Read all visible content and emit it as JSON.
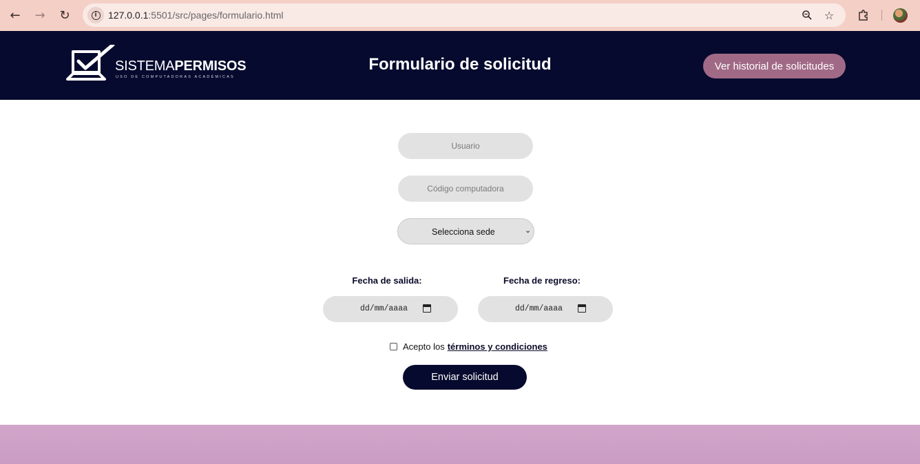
{
  "browser": {
    "url_host": "127.0.0.1",
    "url_path": ":5501/src/pages/formulario.html",
    "back_icon": "arrow-left-icon",
    "forward_icon": "arrow-right-icon",
    "reload_icon": "reload-icon",
    "zoom_icon": "zoom-out-icon",
    "bookmark_icon": "star-icon",
    "extensions_icon": "puzzle-icon"
  },
  "header": {
    "logo_light": "SISTEMA",
    "logo_bold": "PERMISOS",
    "logo_tagline": "USO DE COMPUTADORAS ACADÉMICAS",
    "title": "Formulario de solicitud",
    "history_button": "Ver historial de solicitudes"
  },
  "form": {
    "user_placeholder": "Usuario",
    "computer_code_placeholder": "Código computadora",
    "site_select": "Selecciona sede",
    "departure_label": "Fecha de salida:",
    "return_label": "Fecha de regreso:",
    "date_placeholder": "dd/mm/aaaa",
    "terms_prefix": "Acepto los",
    "terms_link": "términos y condiciones",
    "submit_button": "Enviar solicitud"
  },
  "colors": {
    "header_bg": "#060a2e",
    "accent_button": "#a06a86",
    "footer": "#cda1c8",
    "chrome": "#f4cfc5"
  }
}
